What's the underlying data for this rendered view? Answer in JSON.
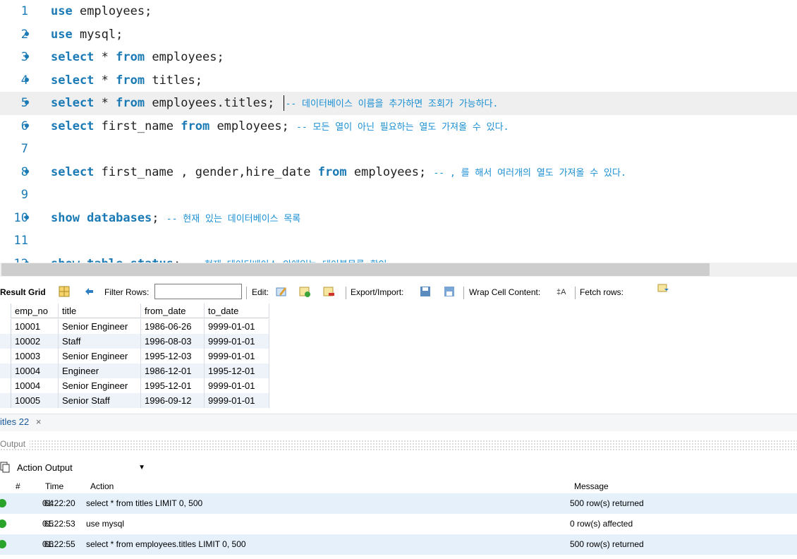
{
  "editor": {
    "lines": [
      {
        "num": "1",
        "dot": false,
        "parts": [
          [
            "kw",
            "use"
          ],
          [
            "tx",
            " employees;"
          ]
        ]
      },
      {
        "num": "2",
        "dot": true,
        "parts": [
          [
            "kw",
            "use"
          ],
          [
            "tx",
            " mysql;"
          ]
        ]
      },
      {
        "num": "3",
        "dot": true,
        "parts": [
          [
            "kw",
            "select"
          ],
          [
            "tx",
            " * "
          ],
          [
            "kw",
            "from"
          ],
          [
            "tx",
            " employees;"
          ]
        ]
      },
      {
        "num": "4",
        "dot": true,
        "parts": [
          [
            "kw",
            "select"
          ],
          [
            "tx",
            " * "
          ],
          [
            "kw",
            "from"
          ],
          [
            "tx",
            " titles;"
          ]
        ]
      },
      {
        "num": "5",
        "dot": true,
        "current": true,
        "parts": [
          [
            "kw",
            "select"
          ],
          [
            "tx",
            " * "
          ],
          [
            "kw",
            "from"
          ],
          [
            "tx",
            " employees.titles; "
          ],
          [
            "caret",
            ""
          ],
          [
            "cm",
            "-- 데이터베이스 이름을 추가하면 조회가 가능하다."
          ]
        ]
      },
      {
        "num": "6",
        "dot": true,
        "parts": [
          [
            "kw",
            "select"
          ],
          [
            "tx",
            " first_name "
          ],
          [
            "kw",
            "from"
          ],
          [
            "tx",
            " employees; "
          ],
          [
            "cm",
            "-- 모든 열이 아닌 필요하는 열도 가져올 수 있다."
          ]
        ]
      },
      {
        "num": "7",
        "dot": false,
        "parts": []
      },
      {
        "num": "8",
        "dot": true,
        "parts": [
          [
            "kw",
            "select"
          ],
          [
            "tx",
            " first_name , gender,hire_date "
          ],
          [
            "kw",
            "from"
          ],
          [
            "tx",
            " employees; "
          ],
          [
            "cm",
            "-- , 를 해서 여러개의 열도 가져올 수 있다."
          ]
        ]
      },
      {
        "num": "9",
        "dot": false,
        "parts": []
      },
      {
        "num": "10",
        "dot": true,
        "parts": [
          [
            "kw",
            "show databases"
          ],
          [
            "tx",
            "; "
          ],
          [
            "cm",
            "-- 현재 있는 데이터베이스 목록"
          ]
        ]
      },
      {
        "num": "11",
        "dot": false,
        "parts": []
      },
      {
        "num": "12",
        "dot": true,
        "parts": [
          [
            "kw",
            "show table status"
          ],
          [
            "tx",
            "; "
          ],
          [
            "cm",
            "-- 현재 데이터베이스 안에있는 테이블목록 확인"
          ]
        ]
      }
    ]
  },
  "result_toolbar": {
    "result_grid": "Result Grid",
    "filter_rows": "Filter Rows:",
    "filter_value": "",
    "edit": "Edit:",
    "export_import": "Export/Import:",
    "wrap_cell": "Wrap Cell Content:",
    "fetch_rows": "Fetch rows:"
  },
  "grid": {
    "columns": [
      "emp_no",
      "title",
      "from_date",
      "to_date"
    ],
    "rows": [
      [
        "10001",
        "Senior Engineer",
        "1986-06-26",
        "9999-01-01"
      ],
      [
        "10002",
        "Staff",
        "1996-08-03",
        "9999-01-01"
      ],
      [
        "10003",
        "Senior Engineer",
        "1995-12-03",
        "9999-01-01"
      ],
      [
        "10004",
        "Engineer",
        "1986-12-01",
        "1995-12-01"
      ],
      [
        "10004",
        "Senior Engineer",
        "1995-12-01",
        "9999-01-01"
      ],
      [
        "10005",
        "Senior Staff",
        "1996-09-12",
        "9999-01-01"
      ]
    ]
  },
  "result_tab": {
    "label": "itles 22",
    "close": "×"
  },
  "output": {
    "title": "Output",
    "selector": "Action Output",
    "headers": {
      "num": "#",
      "time": "Time",
      "action": "Action",
      "message": "Message"
    },
    "rows": [
      {
        "num": "64",
        "time": "01:22:20",
        "action": "select * from titles LIMIT 0, 500",
        "message": "500 row(s) returned"
      },
      {
        "num": "65",
        "time": "01:22:53",
        "action": "use mysql",
        "message": "0 row(s) affected"
      },
      {
        "num": "66",
        "time": "01:22:55",
        "action": "select * from employees.titles LIMIT 0, 500",
        "message": "500 row(s) returned"
      }
    ]
  },
  "colors": {
    "keyword": "#1a7ab5",
    "comment": "#1a8fd3",
    "success": "#2aa32a"
  }
}
